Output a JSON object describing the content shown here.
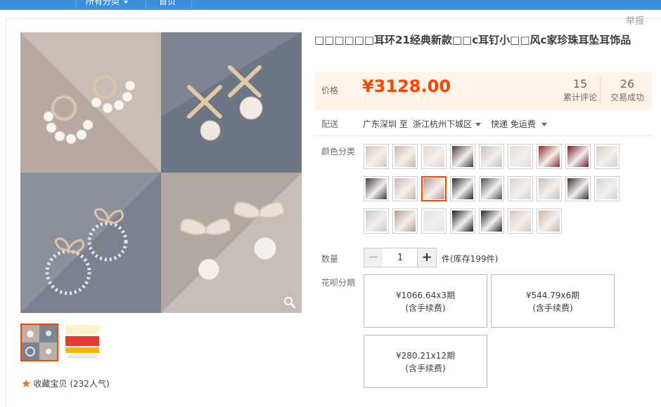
{
  "nav": {
    "all_categories": "所有分类",
    "home": "首页"
  },
  "report_label": "举报",
  "title": "□□□□□□耳环21经典新款□□c耳钉小□□风c家珍珠耳坠耳饰品",
  "price": {
    "label": "价格",
    "value": "¥3128.00"
  },
  "stats": [
    {
      "value": "15",
      "label": "累计评论"
    },
    {
      "value": "26",
      "label": "交易成功"
    }
  ],
  "shipping": {
    "label": "配送",
    "from": "广东深圳 至",
    "to": "浙江杭州下城区",
    "method": "快递 免运费"
  },
  "color": {
    "label": "颜色分类",
    "swatch_count": 25,
    "selected_index": 11
  },
  "quantity": {
    "label": "数量",
    "value": "1",
    "minus": "−",
    "plus": "+",
    "stock": "件(库存199件)"
  },
  "installment": {
    "label": "花呗分期",
    "options": [
      {
        "amount": "¥1066.64x3期",
        "fee": "(含手续费)"
      },
      {
        "amount": "¥544.79x6期",
        "fee": "(含手续费)"
      },
      {
        "amount": "¥280.21x12期",
        "fee": "(含手续费)"
      }
    ]
  },
  "favorite": {
    "label": "收藏宝贝",
    "count": "(232人气)"
  },
  "icons": {
    "zoom": "zoom-icon",
    "star": "star-icon",
    "dropdown": "chevron-down-icon"
  },
  "colors": {
    "accent": "#ff4400",
    "price_bg": "#fff2e8",
    "nav_bg": "#3b8fdf"
  }
}
